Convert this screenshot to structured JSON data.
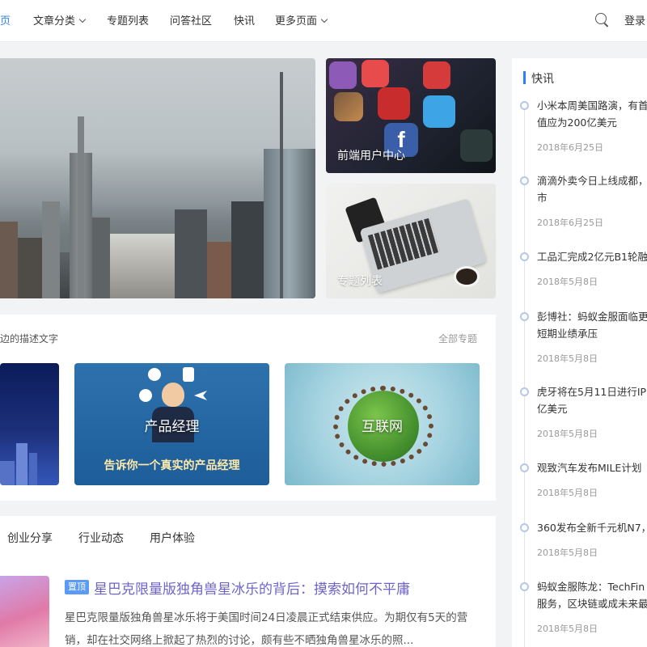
{
  "nav": {
    "items": [
      "页",
      "文章分类",
      "专题列表",
      "问答社区",
      "快讯",
      "更多页面"
    ],
    "login": "登录"
  },
  "hero": {
    "tiles": [
      {
        "label": "前端用户中心"
      },
      {
        "label": "专题列表"
      }
    ]
  },
  "topics": {
    "description": "边的描述文字",
    "more": "全部专题",
    "cards": [
      {
        "title": "",
        "subtitle": ""
      },
      {
        "title": "产品经理",
        "subtitle": "告诉你一个真实的产品经理"
      },
      {
        "title": "互联网",
        "subtitle": ""
      }
    ]
  },
  "tabs": [
    "创业分享",
    "行业动态",
    "用户体验"
  ],
  "article": {
    "badge": "置顶",
    "title": "星巴克限量版独角兽星冰乐的背后：摸索如何不平庸",
    "excerpt": "星巴克限量版独角兽星冰乐将于美国时间24日凌晨正式结束供应。为期仅有5天的营销，却在社交网络上掀起了热烈的讨论，颇有些不晒独角兽星冰乐的照..."
  },
  "flash": {
    "title": "快讯",
    "items": [
      {
        "lines": [
          "小米本周美国路演，有首",
          "值应为200亿美元"
        ],
        "date": "2018年6月25日"
      },
      {
        "lines": [
          "滴滴外卖今日上线成都，",
          "市"
        ],
        "date": "2018年6月25日"
      },
      {
        "lines": [
          "工品汇完成2亿元B1轮融"
        ],
        "date": "2018年5月8日"
      },
      {
        "lines": [
          "彭博社：蚂蚁金服面临更",
          "短期业绩承压"
        ],
        "date": "2018年5月8日"
      },
      {
        "lines": [
          "虎牙将在5月11日进行IP",
          "亿美元"
        ],
        "date": "2018年5月8日"
      },
      {
        "lines": [
          "观致汽车发布MILE计划"
        ],
        "date": "2018年5月8日"
      },
      {
        "lines": [
          "360发布全新千元机N7，"
        ],
        "date": "2018年5月8日"
      },
      {
        "lines": [
          "蚂蚁金服陈龙：TechFin",
          "服务，区块链或成未来最"
        ],
        "date": "2018年5月8日"
      }
    ]
  },
  "colors": {
    "accent": "#2d7ff9",
    "article_title": "#6f63c9",
    "badge": "#5b9bf5"
  }
}
